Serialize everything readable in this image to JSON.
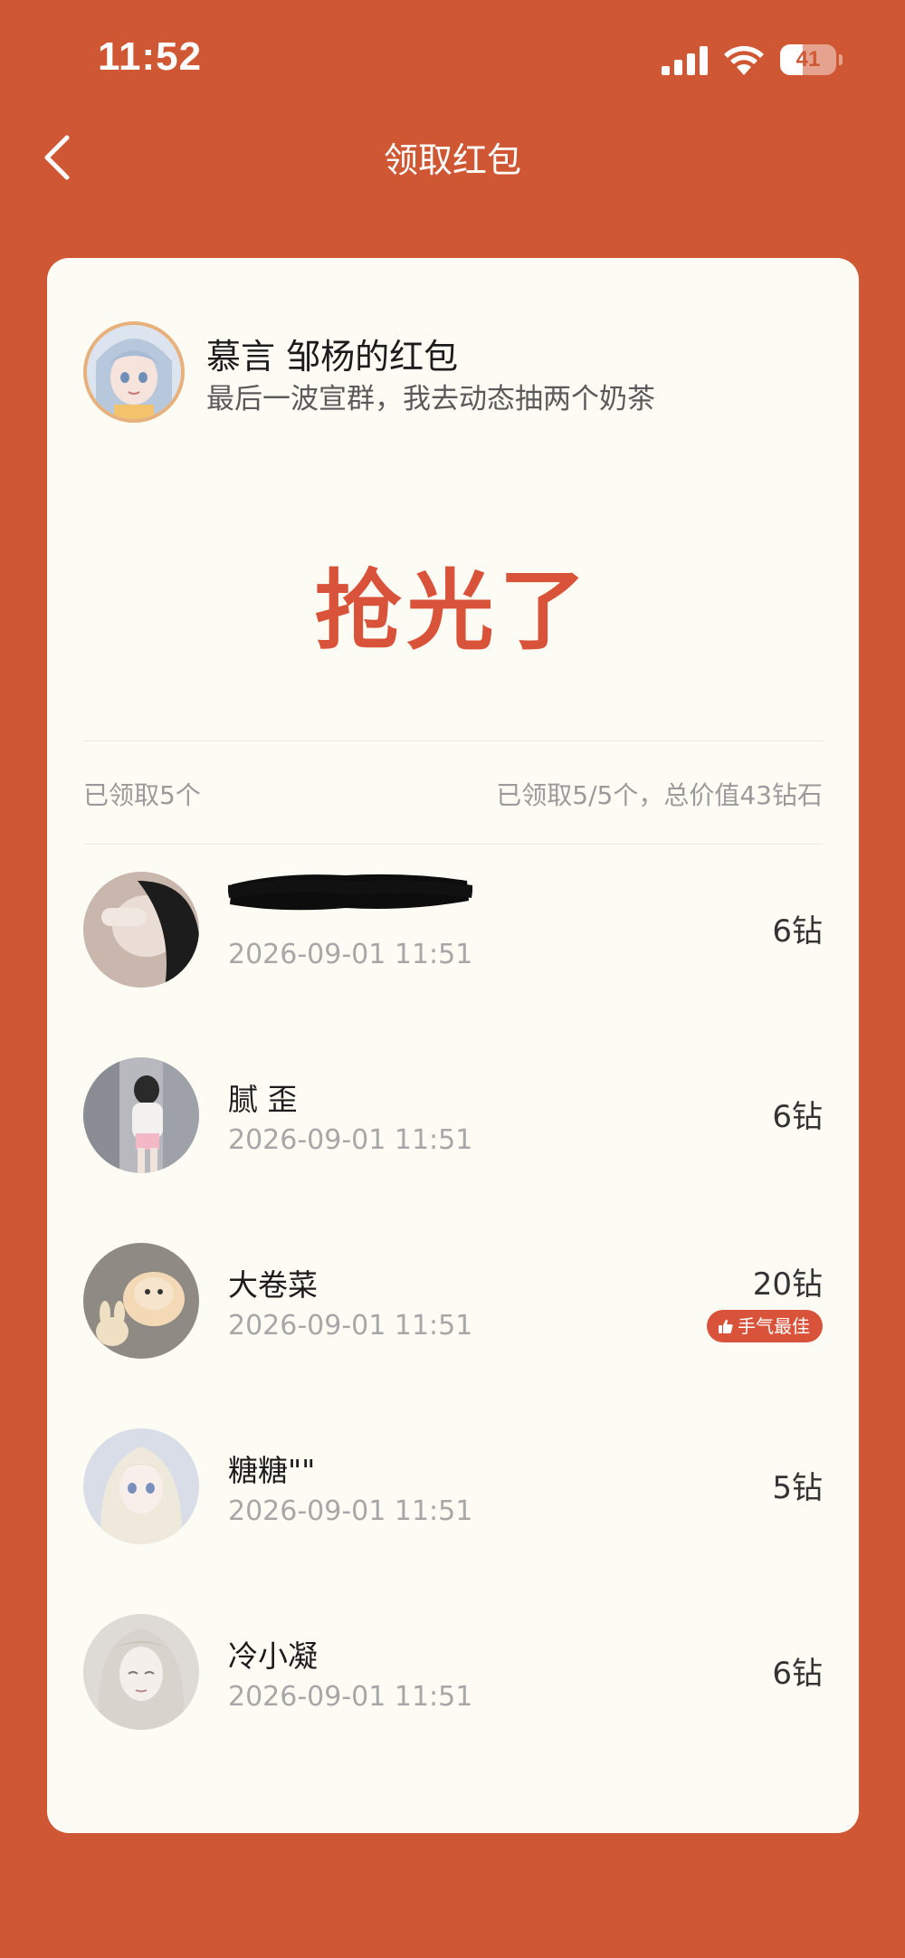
{
  "status_bar": {
    "time": "11:52",
    "battery": "41",
    "battery_level_percent": 41
  },
  "nav": {
    "title": "领取红包",
    "back_icon": "chevron-left-icon"
  },
  "sender": {
    "name": "慕言  邹杨的红包",
    "message": "最后一波宣群，我去动态抽两个奶茶"
  },
  "status_text": "抢光了",
  "summary": {
    "left": "已领取5个",
    "right": "已领取5/5个，总价值43钻石"
  },
  "recipients": [
    {
      "name": "",
      "name_redacted": true,
      "time": "2026-09-01 11:51",
      "amount": "6钻",
      "avatar_color": "#c9b6ac"
    },
    {
      "name": "腻 歪",
      "time": "2026-09-01 11:51",
      "amount": "6钻",
      "avatar_color": "#b7b9bf"
    },
    {
      "name": "大卷菜",
      "time": "2026-09-01 11:51",
      "amount": "20钻",
      "best": true,
      "best_label": "手气最佳",
      "avatar_color": "#8f8a84"
    },
    {
      "name": "糖糖\"\"",
      "time": "2026-09-01 11:51",
      "amount": "5钻",
      "avatar_color": "#d9dde8"
    },
    {
      "name": "冷小凝",
      "time": "2026-09-01 11:51",
      "amount": "6钻",
      "avatar_color": "#dedbd6"
    }
  ],
  "colors": {
    "background": "#cf5734",
    "card": "#fdfcf4",
    "accent": "#d9533a"
  }
}
